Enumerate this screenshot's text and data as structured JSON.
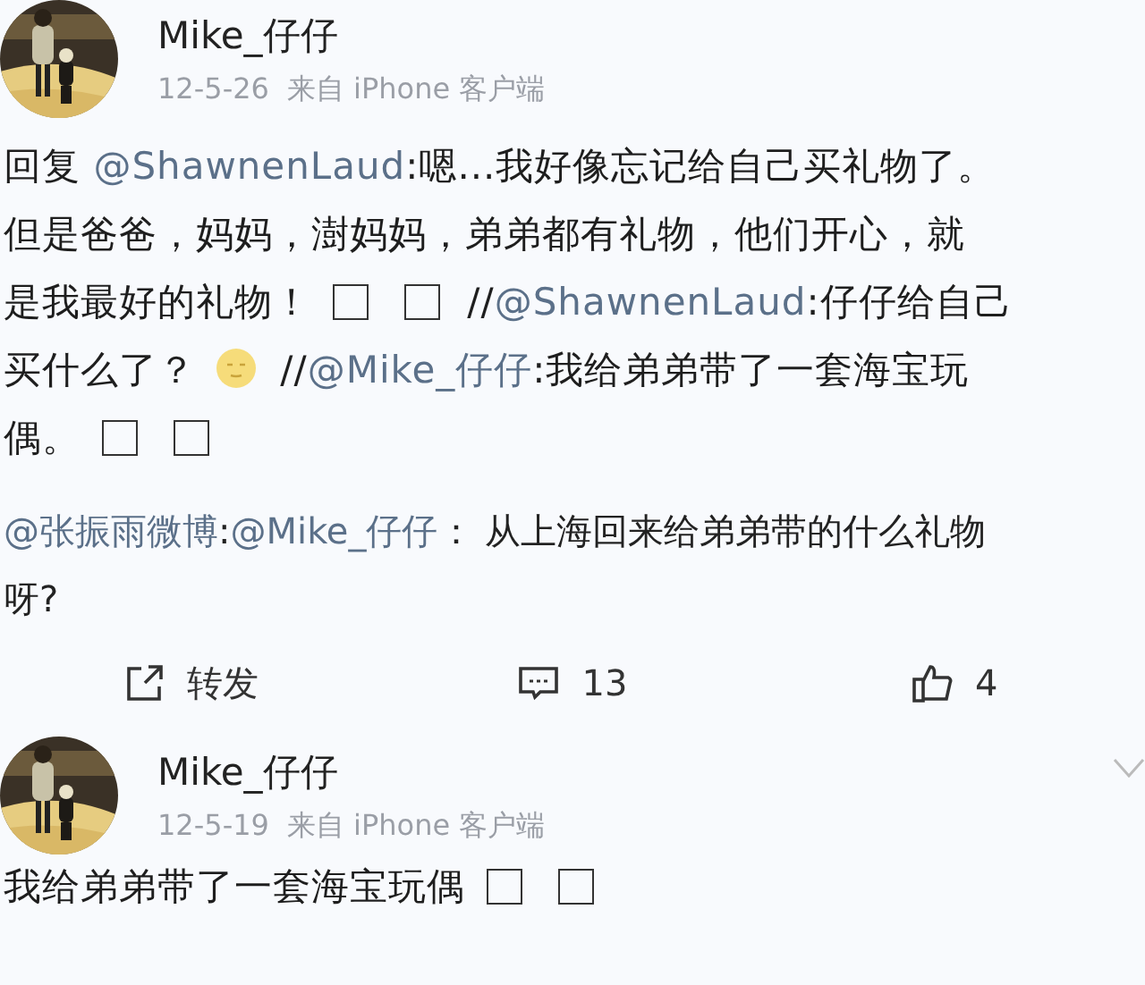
{
  "posts": [
    {
      "avatar": {
        "kind": "picture"
      },
      "username": "Mike_仔仔",
      "date": "12-5-26",
      "source": "来自 iPhone 客户端",
      "menu": false,
      "lines": [
        [
          {
            "kind": "text",
            "text": "回复 "
          },
          {
            "kind": "mention",
            "text": "@ShawnenLaud"
          },
          {
            "kind": "text",
            "text": ":嗯...我好像忘记给自己买礼物了。"
          }
        ],
        [
          {
            "kind": "text",
            "text": "但是爸爸，妈妈，澍妈妈，弟弟都有礼物，他们开心，就"
          }
        ],
        [
          {
            "kind": "text",
            "text": "是我最好的礼物！"
          },
          {
            "kind": "box"
          },
          {
            "kind": "box"
          },
          {
            "kind": "text",
            "text": " //"
          },
          {
            "kind": "mention",
            "text": "@ShawnenLaud"
          },
          {
            "kind": "text",
            "text": ":仔仔给自己"
          }
        ],
        [
          {
            "kind": "text",
            "text": "买什么了？"
          },
          {
            "kind": "emoji"
          },
          {
            "kind": "text",
            "text": " //"
          },
          {
            "kind": "mention",
            "text": "@Mike_仔仔"
          },
          {
            "kind": "text",
            "text": ":我给弟弟带了一套海宝玩"
          }
        ],
        [
          {
            "kind": "text",
            "text": "偶。"
          },
          {
            "kind": "box"
          },
          {
            "kind": "box"
          }
        ]
      ],
      "quote": [
        [
          {
            "kind": "mention",
            "text": "@张振雨微博"
          },
          {
            "kind": "text",
            "text": ":"
          },
          {
            "kind": "mention",
            "text": "@Mike_仔仔"
          },
          {
            "kind": "text",
            "text": "： 从上海回来给弟弟带的什么礼物"
          }
        ],
        [
          {
            "kind": "text",
            "text": "呀?"
          }
        ]
      ],
      "actions": [
        {
          "kind": "repost",
          "label": "转发"
        },
        {
          "kind": "comment",
          "label": "13"
        },
        {
          "kind": "like",
          "label": "4"
        }
      ]
    },
    {
      "avatar": {
        "kind": "picture"
      },
      "username": "Mike_仔仔",
      "date": "12-5-19",
      "source": "来自 iPhone 客户端",
      "menu": true,
      "lines": [
        [
          {
            "kind": "text",
            "text": "我给弟弟带了一套海宝玩偶"
          },
          {
            "kind": "box"
          },
          {
            "kind": "box"
          }
        ]
      ]
    }
  ]
}
